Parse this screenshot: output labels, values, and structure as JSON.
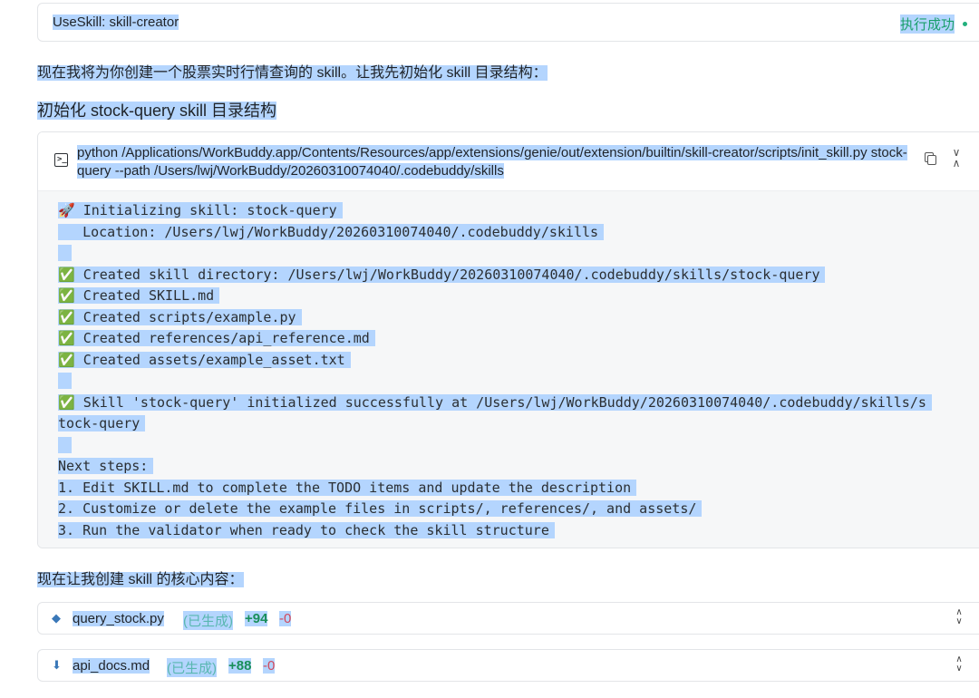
{
  "tool_call": {
    "title": "UseSkill: skill-creator",
    "status": "执行成功",
    "status_color": "#1a9f6b"
  },
  "messages": {
    "intro": "现在我将为你创建一个股票实时行情查询的 skill。让我先初始化 skill 目录结构：",
    "step_heading": "初始化 stock-query skill 目录结构",
    "next": "现在让我创建 skill 的核心内容："
  },
  "terminal": {
    "icon": "terminal-icon",
    "command": "python /Applications/WorkBuddy.app/Contents/Resources/app/extensions/genie/out/extension/builtin/skill-creator/scripts/init_skill.py stock-query --path /Users/lwj/WorkBuddy/20260310074040/.codebuddy/skills",
    "output": [
      "🚀 Initializing skill: stock-query",
      "   Location: /Users/lwj/WorkBuddy/20260310074040/.codebuddy/skills",
      "",
      "✅ Created skill directory: /Users/lwj/WorkBuddy/20260310074040/.codebuddy/skills/stock-query",
      "✅ Created SKILL.md",
      "✅ Created scripts/example.py",
      "✅ Created references/api_reference.md",
      "✅ Created assets/example_asset.txt",
      "",
      "✅ Skill 'stock-query' initialized successfully at /Users/lwj/WorkBuddy/20260310074040/.codebuddy/skills/s",
      "tock-query",
      "",
      "Next steps:",
      "1. Edit SKILL.md to complete the TODO items and update the description",
      "2. Customize or delete the example files in scripts/, references/, and assets/",
      "3. Run the validator when ready to check the skill structure"
    ]
  },
  "files": [
    {
      "icon": "python-file-icon",
      "name": "query_stock.py",
      "status": "(已生成)",
      "added": "+94",
      "removed": "-0"
    },
    {
      "icon": "markdown-file-icon",
      "name": "api_docs.md",
      "status": "(已生成)",
      "added": "+88",
      "removed": "-0"
    }
  ],
  "colors": {
    "selection": "#b4d5fe",
    "terminal_bg": "#f6f7f8",
    "added": "#1a8f5a",
    "removed": "#d1495b"
  }
}
